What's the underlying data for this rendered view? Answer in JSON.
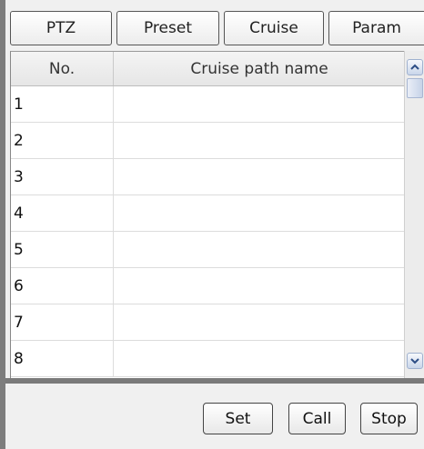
{
  "tabs": {
    "ptz": "PTZ",
    "preset": "Preset",
    "cruise": "Cruise",
    "param": "Param"
  },
  "table": {
    "columns": [
      "No.",
      "Cruise path name"
    ],
    "rows": [
      {
        "no": "1",
        "name": ""
      },
      {
        "no": "2",
        "name": ""
      },
      {
        "no": "3",
        "name": ""
      },
      {
        "no": "4",
        "name": ""
      },
      {
        "no": "5",
        "name": ""
      },
      {
        "no": "6",
        "name": ""
      },
      {
        "no": "7",
        "name": ""
      },
      {
        "no": "8",
        "name": ""
      }
    ]
  },
  "actions": {
    "set": "Set",
    "call": "Call",
    "stop": "Stop"
  },
  "icons": {
    "scroll_up": "chevron-up-icon",
    "scroll_down": "chevron-down-icon"
  }
}
